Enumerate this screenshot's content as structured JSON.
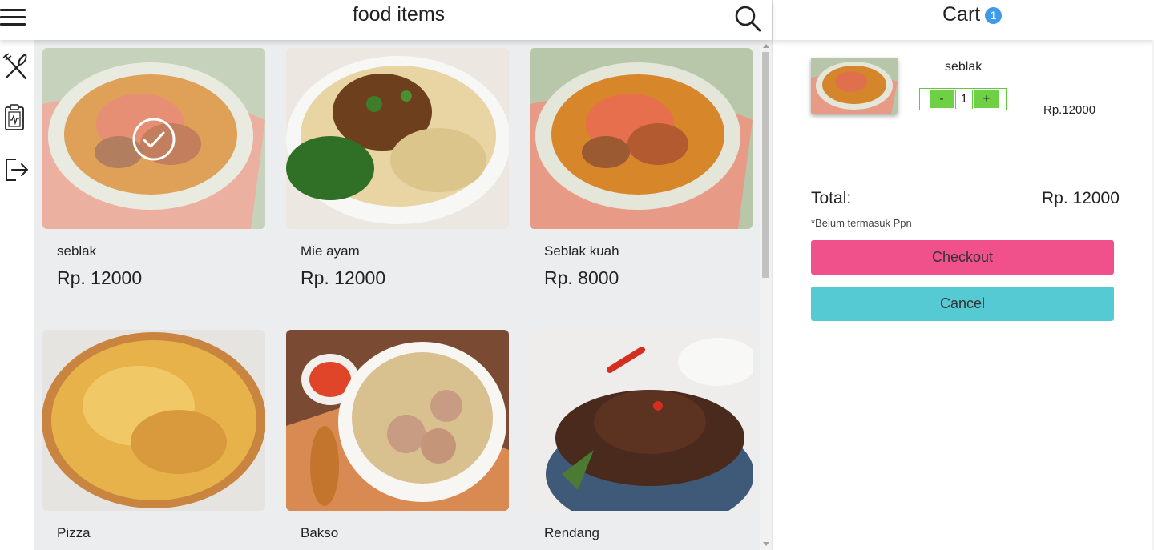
{
  "header": {
    "title": "food items"
  },
  "sidebar": {
    "items": [
      {
        "icon": "utensils-icon"
      },
      {
        "icon": "clipboard-icon"
      },
      {
        "icon": "logout-icon"
      }
    ]
  },
  "menu": {
    "items": [
      {
        "name": "seblak",
        "price": "Rp. 12000",
        "selected": true
      },
      {
        "name": "Mie ayam",
        "price": "Rp. 12000",
        "selected": false
      },
      {
        "name": "Seblak kuah",
        "price": "Rp. 8000",
        "selected": false
      },
      {
        "name": "Pizza",
        "price": "",
        "selected": false
      },
      {
        "name": "Bakso",
        "price": "",
        "selected": false
      },
      {
        "name": "Rendang",
        "price": "",
        "selected": false
      }
    ]
  },
  "cart": {
    "title": "Cart",
    "badge": "1",
    "items": [
      {
        "name": "seblak",
        "quantity": "1",
        "price": "Rp.12000",
        "minus": "-",
        "plus": "+"
      }
    ],
    "total_label": "Total:",
    "total_value": "Rp. 12000",
    "tax_note": "*Belum termasuk Ppn",
    "checkout_label": "Checkout",
    "cancel_label": "Cancel"
  },
  "colors": {
    "checkout": "#f0518a",
    "cancel": "#56cad3",
    "badge": "#3d9be9",
    "qty": "#6ed145",
    "content_bg": "#ebedef"
  }
}
